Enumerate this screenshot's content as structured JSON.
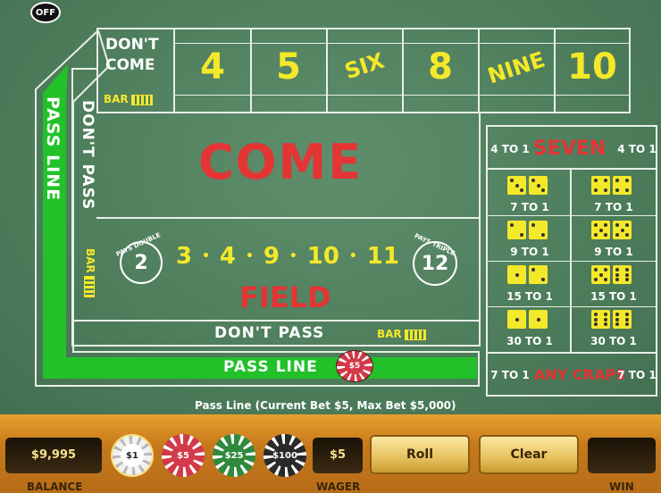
{
  "off_button": "OFF",
  "dont_come": [
    "DON'T",
    "COME"
  ],
  "bar": "BAR",
  "point_numbers": [
    "4",
    "5",
    "SIX",
    "8",
    "NINE",
    "10"
  ],
  "come": "COME",
  "pass_line": "PASS LINE",
  "dont_pass": "DON'T PASS",
  "field": {
    "label": "FIELD",
    "numbers": [
      "3",
      "4",
      "9",
      "10",
      "11"
    ],
    "two": "2",
    "twelve": "12",
    "pays_double": "PAYS DOUBLE",
    "pays_triple": "PAYS TRIPLE"
  },
  "proposition": {
    "seven_left": "4 TO 1",
    "seven": "SEVEN",
    "seven_right": "4 TO 1",
    "hardways": [
      {
        "odds": "7 TO 1",
        "dice": [
          3,
          3
        ]
      },
      {
        "odds": "7 TO 1",
        "dice": [
          4,
          4
        ]
      },
      {
        "odds": "9 TO 1",
        "dice": [
          2,
          2
        ]
      },
      {
        "odds": "9 TO 1",
        "dice": [
          5,
          5
        ]
      },
      {
        "odds": "15 TO 1",
        "dice": [
          1,
          2
        ]
      },
      {
        "odds": "15 TO 1",
        "dice": [
          5,
          6
        ]
      },
      {
        "odds": "30 TO 1",
        "dice": [
          1,
          1
        ]
      },
      {
        "odds": "30 TO 1",
        "dice": [
          6,
          6
        ]
      }
    ],
    "craps_left": "7 TO 1",
    "any_craps": "ANY CRAPS",
    "craps_right": "7 TO 1"
  },
  "table_chip": "$5",
  "status": "Pass Line (Current Bet $5,  Max Bet $5,000)",
  "balance": {
    "value": "$9,995",
    "label": "BALANCE"
  },
  "chips": [
    {
      "label": "$1",
      "color": "#f2f2f2"
    },
    {
      "label": "$5",
      "color": "#d23a4a"
    },
    {
      "label": "$25",
      "color": "#2f8a3c"
    },
    {
      "label": "$100",
      "color": "#2a2a2a"
    }
  ],
  "wager": {
    "value": "$5",
    "label": "WAGER"
  },
  "roll_button": "Roll",
  "clear_button": "Clear",
  "win": {
    "value": "",
    "label": "WIN"
  }
}
